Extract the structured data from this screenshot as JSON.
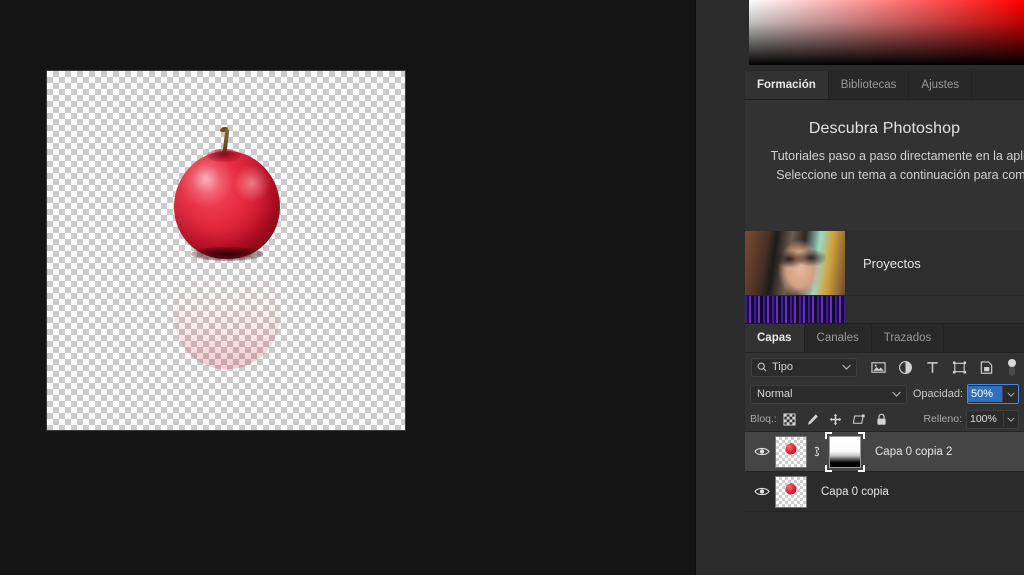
{
  "canvas": {
    "document_name": "",
    "image_description": "red-apple-with-reflection"
  },
  "color_panel": {
    "gradient_hue": "#ff0000",
    "name": "color-picker-gradient"
  },
  "learn_panel": {
    "tabs": [
      {
        "label": "Formación",
        "active": true
      },
      {
        "label": "Bibliotecas",
        "active": false
      },
      {
        "label": "Ajustes",
        "active": false
      }
    ],
    "title": "Descubra Photoshop",
    "description": "Tutoriales paso a paso directamente en la aplicación. Seleccione un tema a continuación para comenzar.",
    "cards": [
      {
        "label": "Proyectos",
        "thumb": "portrait-thumbnail"
      },
      {
        "label": "",
        "thumb": "filmstrip-thumbnail"
      }
    ]
  },
  "layers_panel": {
    "tabs": [
      {
        "label": "Capas",
        "active": true
      },
      {
        "label": "Canales",
        "active": false
      },
      {
        "label": "Trazados",
        "active": false
      }
    ],
    "filter": {
      "search_icon": "search-icon",
      "type_label": "Tipo",
      "icons": [
        "pixel-layer-filter-icon",
        "adjustment-layer-filter-icon",
        "type-layer-filter-icon",
        "shape-layer-filter-icon",
        "smart-object-filter-icon"
      ],
      "toggle": "filter-enable-toggle"
    },
    "blend": {
      "mode": "Normal",
      "opacity_label": "Opacidad:",
      "opacity_value": "50%"
    },
    "lock": {
      "label": "Bloq.:",
      "icons": [
        "lock-transparency-icon",
        "lock-image-pixels-icon",
        "lock-position-icon",
        "lock-artboard-nesting-icon",
        "lock-all-icon"
      ],
      "fill_label": "Relleno:",
      "fill_value": "100%"
    },
    "layers": [
      {
        "name": "Capa 0 copia 2",
        "visible": true,
        "selected": true,
        "has_mask": true,
        "linked": true
      },
      {
        "name": "Capa 0 copia",
        "visible": true,
        "selected": false,
        "has_mask": false,
        "linked": false
      }
    ]
  },
  "colors": {
    "panel_bg": "#2b2b2b",
    "panel_bg_light": "#323232",
    "canvas_bg": "#141414",
    "selection_blue": "#2f6fc2",
    "selected_row": "#454545",
    "text_primary": "#e6e6e6",
    "text_muted": "#9a9a9a"
  }
}
